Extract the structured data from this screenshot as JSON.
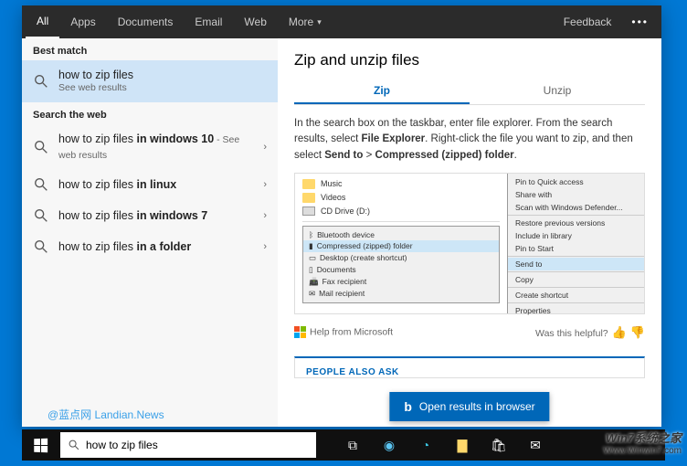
{
  "tabs": {
    "all": "All",
    "apps": "Apps",
    "documents": "Documents",
    "email": "Email",
    "web": "Web",
    "more": "More",
    "feedback": "Feedback"
  },
  "left": {
    "best_match": "Best match",
    "best_title": "how to zip files",
    "best_sub": "See web results",
    "search_web": "Search the web",
    "r1_pre": "how to zip files ",
    "r1_b": "in windows 10",
    "r1_post": " - See web results",
    "r2_pre": "how to zip files ",
    "r2_b": "in linux",
    "r3_pre": "how to zip files ",
    "r3_b": "in windows 7",
    "r4_pre": "how to zip files ",
    "r4_b": "in a folder"
  },
  "right": {
    "title": "Zip and unzip files",
    "tab_zip": "Zip",
    "tab_unzip": "Unzip",
    "p_a": "In the search box on the taskbar, enter file explorer. From the search results, select ",
    "p_b": "File Explorer",
    "p_c": ". Right-click the file you want to zip, and then select ",
    "p_d": "Send to",
    "p_e": " > ",
    "p_f": "Compressed (zipped) folder",
    "p_g": ".",
    "help": "Help from Microsoft",
    "helpful": "Was this helpful?",
    "paa": "PEOPLE ALSO ASK",
    "open": "Open results in browser"
  },
  "mock": {
    "music": "Music",
    "videos": "Videos",
    "cd": "CD Drive (D:)",
    "bt": "Bluetooth device",
    "comp": "Compressed (zipped) folder",
    "desk": "Desktop (create shortcut)",
    "docs": "Documents",
    "fax": "Fax recipient",
    "mail": "Mail recipient",
    "quick": "Pin to Quick access",
    "share": "Share with",
    "scan": "Scan with Windows Defender...",
    "restore": "Restore previous versions",
    "include": "Include in library",
    "pin": "Pin to Start",
    "sendto": "Send to",
    "copy": "Copy",
    "shortcut": "Create shortcut",
    "props": "Properties"
  },
  "taskbar": {
    "query": "how to zip files"
  },
  "wm": {
    "left": "@蓝点网 Landian.News",
    "r1": "Win7系统之家",
    "r2": "Www.Winwin7.com"
  }
}
